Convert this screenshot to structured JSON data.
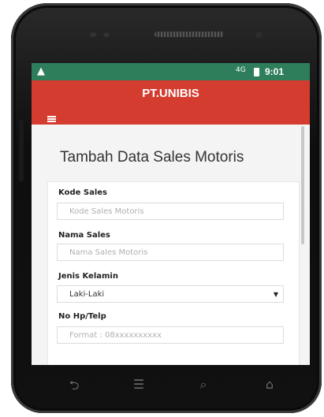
{
  "status_bar": {
    "warning_icon": "alert-triangle-icon",
    "network": "4G",
    "battery_icon": "battery-icon",
    "time": "9:01"
  },
  "app_bar": {
    "title": "PT.UNIBIS",
    "menu_icon": "hamburger-menu-icon"
  },
  "page": {
    "heading": "Tambah Data Sales Motoris"
  },
  "form": {
    "kode_sales": {
      "label": "Kode Sales",
      "placeholder": "Kode Sales Motoris"
    },
    "nama_sales": {
      "label": "Nama Sales",
      "placeholder": "Nama Sales Motoris"
    },
    "jenis_kelamin": {
      "label": "Jenis Kelamin",
      "value": "Laki-Laki"
    },
    "no_hp": {
      "label": "No Hp/Telp",
      "placeholder": "Format : 08xxxxxxxxxx"
    }
  },
  "nav_bar": {
    "back_icon": "back-icon",
    "menu_icon": "menu-icon",
    "search_icon": "search-icon",
    "home_icon": "home-icon"
  },
  "colors": {
    "status_bar": "#2e7d5b",
    "app_bar": "#d33c2f",
    "background": "#f4f4f4"
  }
}
